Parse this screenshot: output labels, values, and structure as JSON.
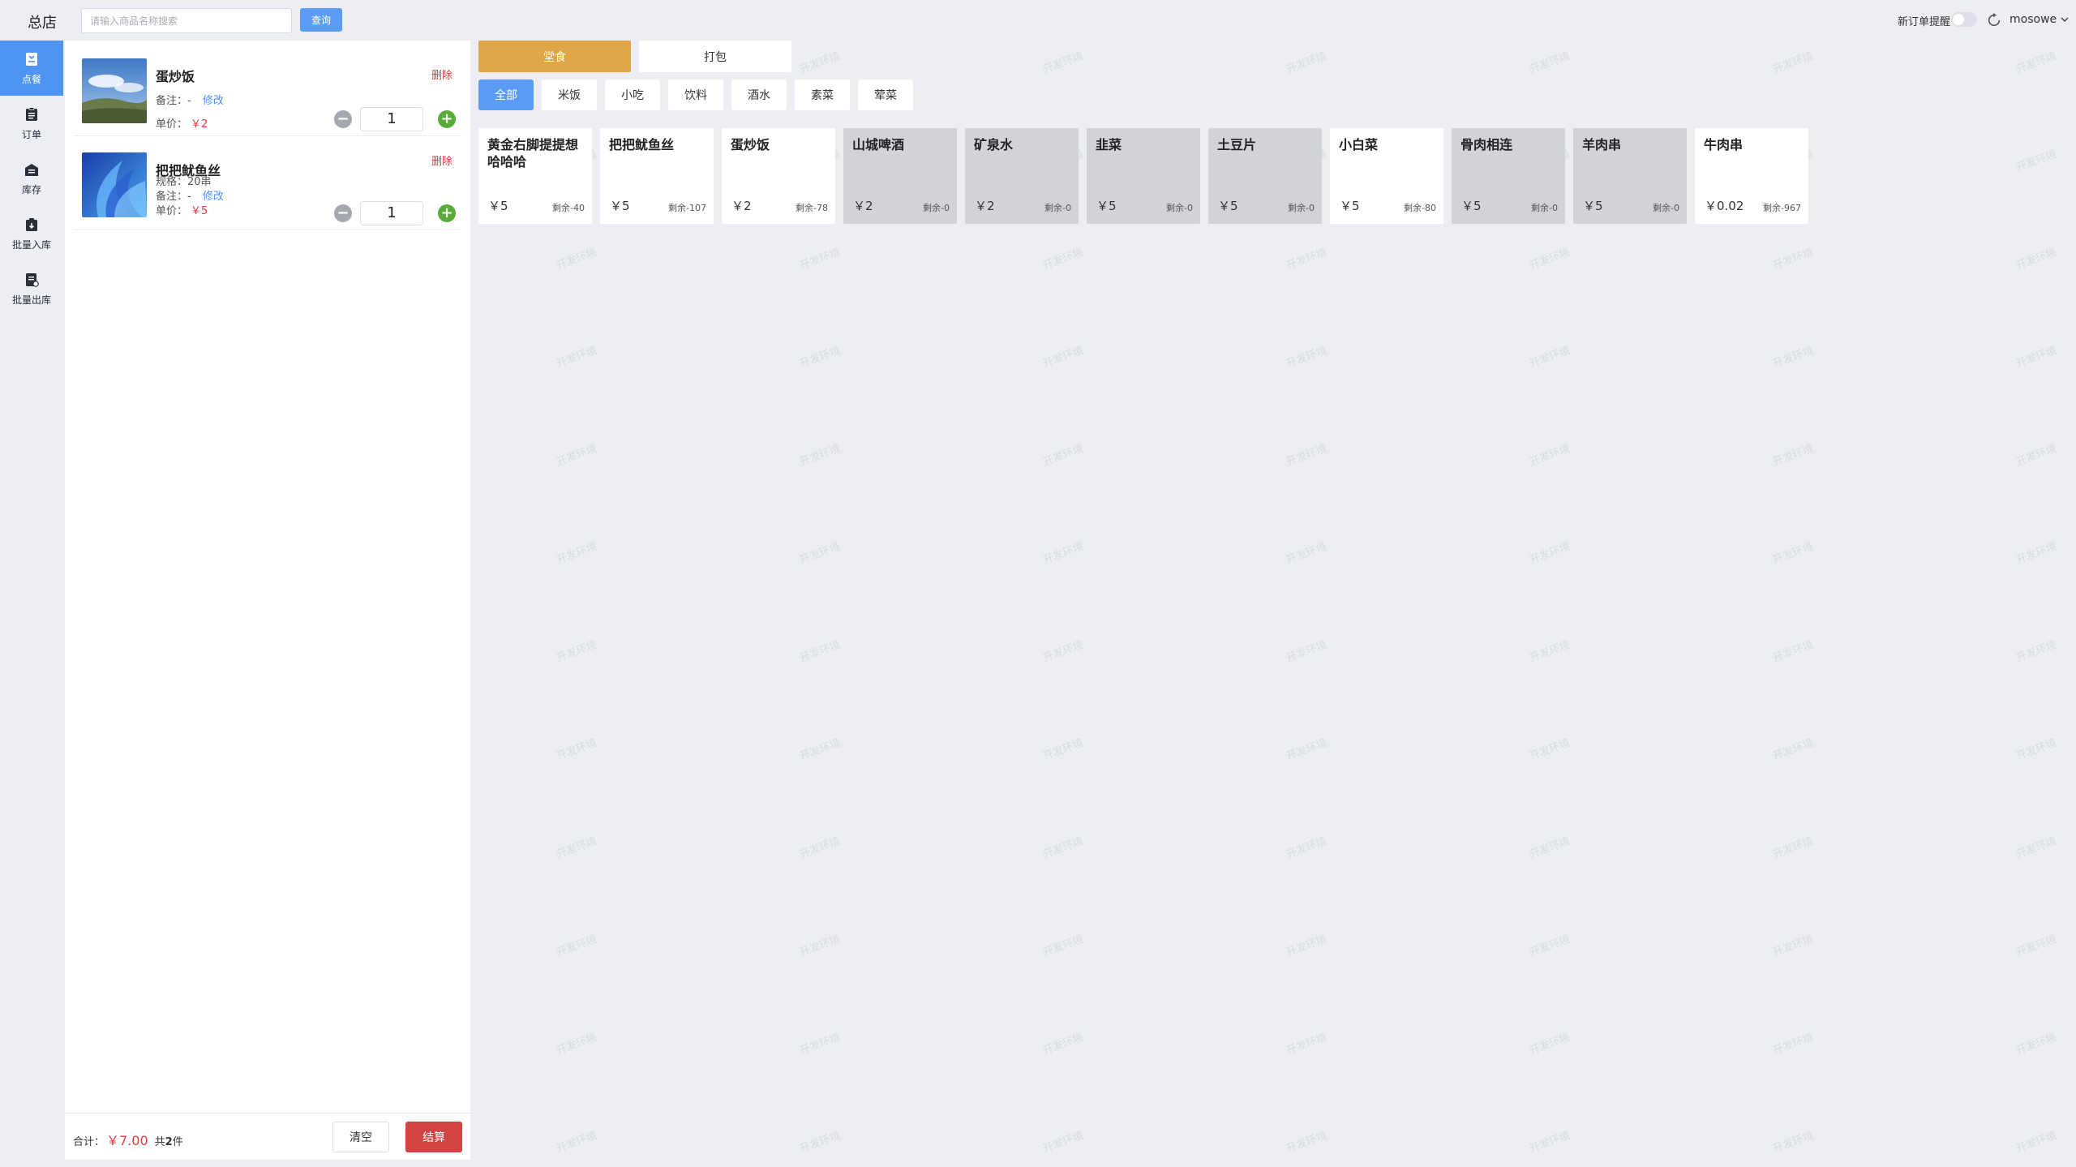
{
  "header": {
    "store_name": "总店",
    "search_placeholder": "请输入商品名称搜索",
    "search_button": "查询",
    "new_order_reminder": "新订单提醒",
    "username": "mosowe"
  },
  "sidebar": {
    "items": [
      {
        "label": "点餐",
        "icon": "menu-icon",
        "active": true
      },
      {
        "label": "订单",
        "icon": "clipboard-icon",
        "active": false
      },
      {
        "label": "库存",
        "icon": "inventory-icon",
        "active": false
      },
      {
        "label": "批量入库",
        "icon": "stock-in-icon",
        "active": false
      },
      {
        "label": "批量出库",
        "icon": "stock-out-icon",
        "active": false
      }
    ]
  },
  "cart": {
    "items": [
      {
        "name": "蛋炒饭",
        "spec": "",
        "remark_label": "备注：",
        "remark_value": "-",
        "edit_link": "修改",
        "price_label": "单价：",
        "price": "￥2",
        "delete": "删除",
        "qty": "1",
        "image": "landscape-photo"
      },
      {
        "name": "把把鱿鱼丝",
        "spec": "规格：20串",
        "remark_label": "备注：",
        "remark_value": "-",
        "edit_link": "修改",
        "price_label": "单价：",
        "price": "￥5",
        "delete": "删除",
        "qty": "1",
        "image": "abstract-blue-wallpaper"
      }
    ],
    "footer": {
      "total_label": "合计：",
      "total_amount": "￥7.00",
      "count_prefix": "共",
      "count": "2",
      "count_suffix": "件",
      "clear_button": "清空",
      "checkout_button": "结算"
    }
  },
  "mode_tabs": [
    {
      "label": "堂食",
      "active": true
    },
    {
      "label": "打包",
      "active": false
    }
  ],
  "category_tabs": [
    {
      "label": "全部",
      "active": true
    },
    {
      "label": "米饭",
      "active": false
    },
    {
      "label": "小吃",
      "active": false
    },
    {
      "label": "饮料",
      "active": false
    },
    {
      "label": "酒水",
      "active": false
    },
    {
      "label": "素菜",
      "active": false
    },
    {
      "label": "荤菜",
      "active": false
    }
  ],
  "products": [
    {
      "name": "黄金右脚提提想哈哈哈",
      "price": "￥5",
      "stock": "剩余-40",
      "sold_out": false
    },
    {
      "name": "把把鱿鱼丝",
      "price": "￥5",
      "stock": "剩余-107",
      "sold_out": false
    },
    {
      "name": "蛋炒饭",
      "price": "￥2",
      "stock": "剩余-78",
      "sold_out": false
    },
    {
      "name": "山城啤酒",
      "price": "￥2",
      "stock": "剩余-0",
      "sold_out": true
    },
    {
      "name": "矿泉水",
      "price": "￥2",
      "stock": "剩余-0",
      "sold_out": true
    },
    {
      "name": "韭菜",
      "price": "￥5",
      "stock": "剩余-0",
      "sold_out": true
    },
    {
      "name": "土豆片",
      "price": "￥5",
      "stock": "剩余-0",
      "sold_out": true
    },
    {
      "name": "小白菜",
      "price": "￥5",
      "stock": "剩余-80",
      "sold_out": false
    },
    {
      "name": "骨肉相连",
      "price": "￥5",
      "stock": "剩余-0",
      "sold_out": true
    },
    {
      "name": "羊肉串",
      "price": "￥5",
      "stock": "剩余-0",
      "sold_out": true
    },
    {
      "name": "牛肉串",
      "price": "￥0.02",
      "stock": "剩余-967",
      "sold_out": false
    }
  ],
  "watermark_text": "开发环境",
  "colors": {
    "primary": "#5b9cf6",
    "accent_orange": "#e0a546",
    "danger": "#e0383e",
    "sold_out_bg": "#d2d3d8"
  }
}
